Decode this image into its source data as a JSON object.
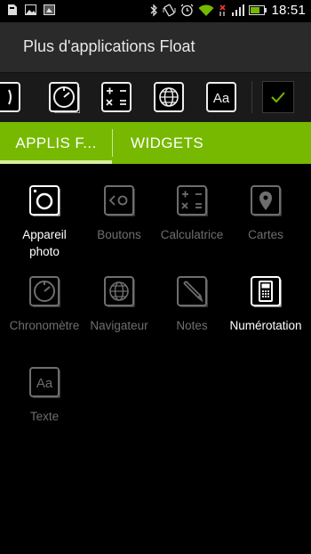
{
  "status_bar": {
    "time": "18:51",
    "left_icons": [
      "sd-card-icon",
      "gallery-icon",
      "notification-icon"
    ],
    "right_icons": [
      "bluetooth-icon",
      "vibrate-icon",
      "alarm-icon",
      "wifi-icon",
      "no-signal-icon",
      "signal-icon",
      "battery-icon"
    ]
  },
  "header": {
    "title": "Plus d'applications Float"
  },
  "tray": {
    "icons": [
      "partial-app-icon",
      "stopwatch-icon",
      "calculator-icon",
      "globe-icon",
      "text-icon"
    ],
    "confirm_icon": "checkmark-icon"
  },
  "tabs": [
    {
      "label": "APPLIS F...",
      "active": true
    },
    {
      "label": "WIDGETS",
      "active": false
    }
  ],
  "apps": [
    {
      "label": "Appareil photo",
      "icon": "camera-icon",
      "enabled": true
    },
    {
      "label": "Boutons",
      "icon": "buttons-icon",
      "enabled": false
    },
    {
      "label": "Calculatrice",
      "icon": "calculator-icon",
      "enabled": false
    },
    {
      "label": "Cartes",
      "icon": "map-pin-icon",
      "enabled": false
    },
    {
      "label": "Chronomètre",
      "icon": "stopwatch-icon",
      "enabled": false
    },
    {
      "label": "Navigateur",
      "icon": "globe-icon",
      "enabled": false
    },
    {
      "label": "Notes",
      "icon": "pencil-icon",
      "enabled": false
    },
    {
      "label": "Numérotation",
      "icon": "dialer-icon",
      "enabled": true
    },
    {
      "label": "Texte",
      "icon": "text-icon",
      "enabled": false
    }
  ],
  "colors": {
    "accent": "#76b900",
    "indicator": "#d4ef9f",
    "disabled_text": "#6e6e6e"
  }
}
